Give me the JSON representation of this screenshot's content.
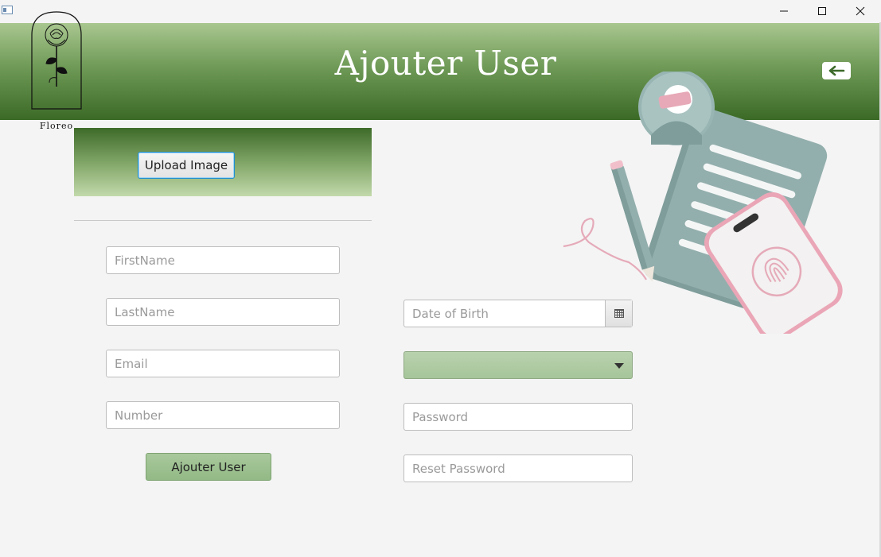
{
  "window": {
    "title": ""
  },
  "header": {
    "title": "Ajouter User",
    "logo_text": "Floreo",
    "back_icon": "arrow-left-icon"
  },
  "upload": {
    "button_label": "Upload Image"
  },
  "form": {
    "firstname": {
      "placeholder": "FirstName",
      "value": ""
    },
    "lastname": {
      "placeholder": "LastName",
      "value": ""
    },
    "email": {
      "placeholder": "Email",
      "value": ""
    },
    "number": {
      "placeholder": "Number",
      "value": ""
    },
    "date_of_birth": {
      "placeholder": "Date of Birth",
      "value": "",
      "icon": "calendar-icon"
    },
    "role_select": {
      "selected": ""
    },
    "password": {
      "placeholder": "Password",
      "value": ""
    },
    "reset_password": {
      "placeholder": "Reset Password",
      "value": ""
    },
    "submit_label": "Ajouter User"
  },
  "colors": {
    "header_top": "#a9c790",
    "header_bottom": "#3b6a26",
    "combo_green": "#a6c59a",
    "button_green": "#93b986",
    "focus_blue": "#1f8fd1"
  }
}
